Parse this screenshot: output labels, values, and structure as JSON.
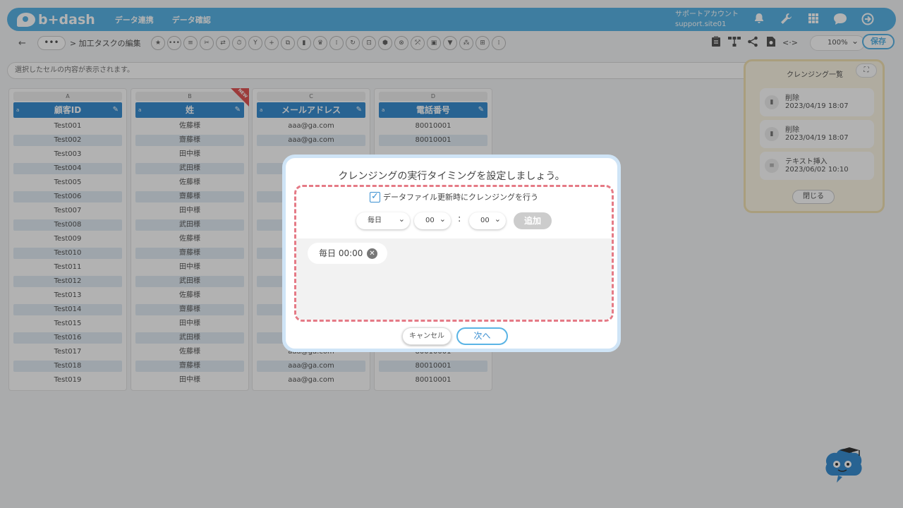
{
  "header": {
    "logo_text": "b+dash",
    "nav": [
      "データ連携",
      "データ確認"
    ],
    "account_name": "サポートアカウント",
    "account_site": "support.site01",
    "icons": [
      "bell-icon",
      "wrench-icon",
      "apps-grid-icon",
      "chat-icon",
      "logout-icon"
    ]
  },
  "toolbar": {
    "back": "←",
    "more": "•••",
    "breadcrumb": "> 加工タスクの編集",
    "tool_glyphs": [
      "★",
      "•••",
      "≡",
      "✂",
      "⇄",
      "⏱",
      "Y",
      "+",
      "⧉",
      "▮",
      "♛",
      "⁞",
      "↻",
      "⊡",
      "⬢",
      "⊗",
      "⤱",
      "▣",
      "▼",
      "⁂",
      "⊞",
      "⁞"
    ],
    "zoom": "100%",
    "save": "保存"
  },
  "cellbar": {
    "placeholder": "選択したセルの内容が表示されます。"
  },
  "columns": [
    {
      "letter": "A",
      "name": "顧客ID",
      "new": false,
      "cells": [
        "Test001",
        "Test002",
        "Test003",
        "Test004",
        "Test005",
        "Test006",
        "Test007",
        "Test008",
        "Test009",
        "Test010",
        "Test011",
        "Test012",
        "Test013",
        "Test014",
        "Test015",
        "Test016",
        "Test017",
        "Test018",
        "Test019"
      ]
    },
    {
      "letter": "B",
      "name": "姓",
      "new": true,
      "cells": [
        "佐藤様",
        "齋藤様",
        "田中様",
        "武田様",
        "佐藤様",
        "齋藤様",
        "田中様",
        "武田様",
        "佐藤様",
        "齋藤様",
        "田中様",
        "武田様",
        "佐藤様",
        "齋藤様",
        "田中様",
        "武田様",
        "佐藤様",
        "齋藤様",
        "田中様"
      ]
    },
    {
      "letter": "C",
      "name": "メールアドレス",
      "new": false,
      "cells": [
        "aaa@ga.com",
        "aaa@ga.com",
        "",
        "",
        "",
        "",
        "",
        "",
        "",
        "",
        "",
        "",
        "",
        "",
        "",
        "",
        "aaa@ga.com",
        "aaa@ga.com",
        "aaa@ga.com"
      ]
    },
    {
      "letter": "D",
      "name": "電話番号",
      "new": false,
      "cells": [
        "80010001",
        "80010001",
        "",
        "",
        "",
        "",
        "",
        "",
        "",
        "",
        "",
        "",
        "",
        "",
        "",
        "",
        "80010001",
        "80010001",
        "80010001"
      ]
    }
  ],
  "column_tag": "NEW",
  "column_prefix": "a",
  "history": {
    "title": "クレンジング一覧",
    "expand": "⛶",
    "items": [
      {
        "label": "削除",
        "date": "2023/04/19 18:07",
        "icon": "trash-icon"
      },
      {
        "label": "削除",
        "date": "2023/04/19 18:07",
        "icon": "trash-icon"
      },
      {
        "label": "テキスト挿入",
        "date": "2023/06/02 10:10",
        "icon": "text-icon"
      }
    ],
    "close": "閉じる"
  },
  "dialog": {
    "title": "クレンジングの実行タイミングを設定しましょう。",
    "checkbox_label": "データファイル更新時にクレンジングを行う",
    "checkbox_checked": true,
    "frequency": "毎日",
    "hour": "00",
    "separator": ":",
    "minute": "00",
    "add": "追加",
    "schedules": [
      "毎日 00:00"
    ],
    "cancel": "キャンセル",
    "next": "次へ"
  }
}
